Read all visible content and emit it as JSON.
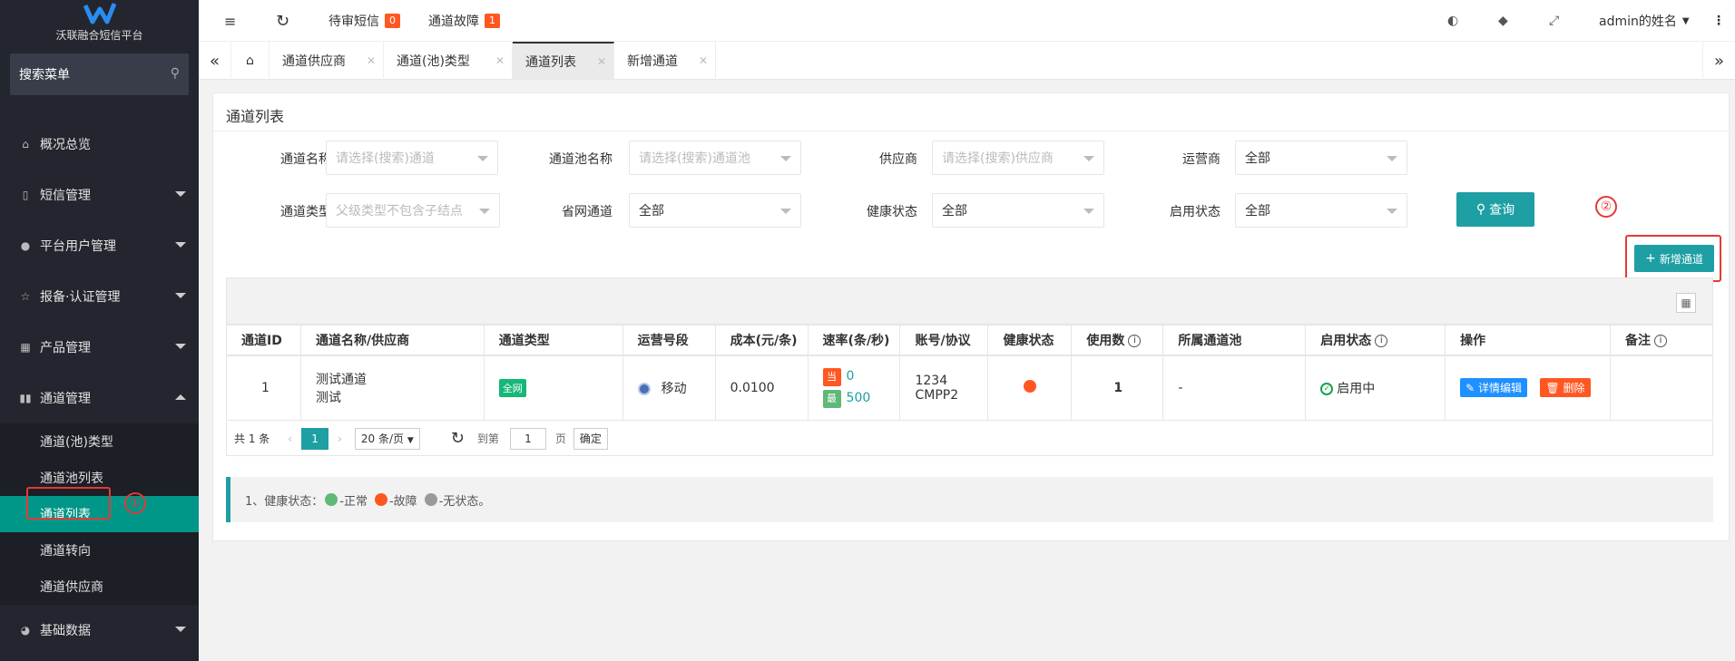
{
  "sidebar": {
    "app_name": "沃联融合短信平台",
    "search_label": "搜索菜单",
    "items": [
      {
        "label": "概况总览"
      },
      {
        "label": "短信管理"
      },
      {
        "label": "平台用户管理"
      },
      {
        "label": "报备·认证管理"
      },
      {
        "label": "产品管理"
      },
      {
        "label": "通道管理"
      }
    ],
    "sub_items": [
      {
        "label": "通道(池)类型"
      },
      {
        "label": "通道池列表"
      },
      {
        "label": "通道列表"
      },
      {
        "label": "通道转向"
      },
      {
        "label": "通道供应商"
      }
    ],
    "last_item": {
      "label": "基础数据"
    },
    "marker_1": "①"
  },
  "topbar": {
    "pending_sms_label": "待审短信",
    "pending_sms_count": "0",
    "channel_fault_label": "通道故障",
    "channel_fault_count": "1",
    "user_name": "admin的姓名"
  },
  "tabs": [
    {
      "label": "通道供应商"
    },
    {
      "label": "通道(池)类型"
    },
    {
      "label": "通道列表"
    },
    {
      "label": "新增通道"
    }
  ],
  "main": {
    "title": "通道列表",
    "filters": {
      "channel_name": {
        "label": "通道名称",
        "placeholder": "请选择(搜索)通道"
      },
      "pool_name": {
        "label": "通道池名称",
        "placeholder": "请选择(搜索)通道池"
      },
      "supplier": {
        "label": "供应商",
        "placeholder": "请选择(搜索)供应商"
      },
      "operator": {
        "label": "运营商",
        "value": "全部"
      },
      "channel_type": {
        "label": "通道类型",
        "placeholder": "父级类型不包含子结点"
      },
      "province": {
        "label": "省网通道",
        "value": "全部"
      },
      "health": {
        "label": "健康状态",
        "value": "全部"
      },
      "enabled": {
        "label": "启用状态",
        "value": "全部"
      }
    },
    "query_label": "查询",
    "add_label": "新增通道",
    "marker_2": "②",
    "table": {
      "headers": [
        "通道ID",
        "通道名称/供应商",
        "通道类型",
        "运营号段",
        "成本(元/条)",
        "速率(条/秒)",
        "账号/协议",
        "健康状态",
        "使用数",
        "所属通道池",
        "启用状态",
        "操作",
        "备注"
      ],
      "rows": [
        {
          "id": "1",
          "name": "测试通道",
          "supplier": "测试",
          "type_tag": "全网",
          "segment": "移动",
          "cost": "0.0100",
          "rate_cur_label": "当",
          "rate_cur": "0",
          "rate_max_label": "最",
          "rate_max": "500",
          "account": "1234",
          "protocol": "CMPP2",
          "usage": "1",
          "pool": "-",
          "status": "启用中",
          "edit_label": "详情编辑",
          "delete_label": "删除",
          "remark": ""
        }
      ]
    },
    "pager": {
      "total": "共 1 条",
      "page": "1",
      "per_page": "20 条/页",
      "goto_label": "到第",
      "goto_value": "1",
      "page_unit": "页",
      "confirm": "确定"
    },
    "note": {
      "prefix": "1、健康状态：",
      "normal": "-正常",
      "fault": "-故障",
      "none": "-无状态。"
    }
  },
  "colors": {
    "accent": "#1e9fa4",
    "sidebar_bg": "#23262e",
    "active_menu": "#009688",
    "badge": "#ff5722",
    "health_normal": "#5fb878",
    "health_fault": "#ff5722",
    "health_none": "#999999"
  }
}
